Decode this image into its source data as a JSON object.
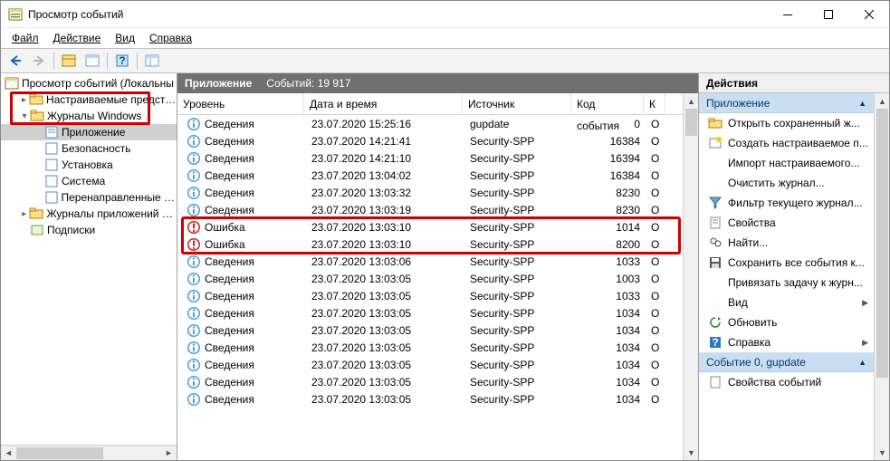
{
  "window": {
    "title": "Просмотр событий"
  },
  "menu": {
    "file": "Файл",
    "action": "Действие",
    "view": "Вид",
    "help": "Справка"
  },
  "tree": {
    "root": "Просмотр событий (Локальны",
    "custom_views": "Настраиваемые представле",
    "win_logs": "Журналы Windows",
    "application": "Приложение",
    "security": "Безопасность",
    "setup": "Установка",
    "system": "Система",
    "forwarded": "Перенаправленные соб",
    "apps_services": "Журналы приложений и сл",
    "subscriptions": "Подписки"
  },
  "center": {
    "title": "Приложение",
    "count_label": "Событий: 19 917",
    "columns": {
      "level": "Уровень",
      "date": "Дата и время",
      "source": "Источник",
      "code": "Код события",
      "k": "К"
    },
    "info_label": "Сведения",
    "error_label": "Ошибка",
    "rows": [
      {
        "lvl": "i",
        "date": "23.07.2020 15:25:16",
        "src": "gupdate",
        "code": "0",
        "k": "О"
      },
      {
        "lvl": "i",
        "date": "23.07.2020 14:21:41",
        "src": "Security-SPP",
        "code": "16384",
        "k": "О"
      },
      {
        "lvl": "i",
        "date": "23.07.2020 14:21:10",
        "src": "Security-SPP",
        "code": "16394",
        "k": "О"
      },
      {
        "lvl": "i",
        "date": "23.07.2020 13:04:02",
        "src": "Security-SPP",
        "code": "16384",
        "k": "О"
      },
      {
        "lvl": "i",
        "date": "23.07.2020 13:03:32",
        "src": "Security-SPP",
        "code": "8230",
        "k": "О"
      },
      {
        "lvl": "i",
        "date": "23.07.2020 13:03:19",
        "src": "Security-SPP",
        "code": "8230",
        "k": "О"
      },
      {
        "lvl": "e",
        "date": "23.07.2020 13:03:10",
        "src": "Security-SPP",
        "code": "1014",
        "k": "О"
      },
      {
        "lvl": "e",
        "date": "23.07.2020 13:03:10",
        "src": "Security-SPP",
        "code": "8200",
        "k": "О"
      },
      {
        "lvl": "i",
        "date": "23.07.2020 13:03:06",
        "src": "Security-SPP",
        "code": "1033",
        "k": "О"
      },
      {
        "lvl": "i",
        "date": "23.07.2020 13:03:05",
        "src": "Security-SPP",
        "code": "1003",
        "k": "О"
      },
      {
        "lvl": "i",
        "date": "23.07.2020 13:03:05",
        "src": "Security-SPP",
        "code": "1033",
        "k": "О"
      },
      {
        "lvl": "i",
        "date": "23.07.2020 13:03:05",
        "src": "Security-SPP",
        "code": "1034",
        "k": "О"
      },
      {
        "lvl": "i",
        "date": "23.07.2020 13:03:05",
        "src": "Security-SPP",
        "code": "1034",
        "k": "О"
      },
      {
        "lvl": "i",
        "date": "23.07.2020 13:03:05",
        "src": "Security-SPP",
        "code": "1034",
        "k": "О"
      },
      {
        "lvl": "i",
        "date": "23.07.2020 13:03:05",
        "src": "Security-SPP",
        "code": "1034",
        "k": "О"
      },
      {
        "lvl": "i",
        "date": "23.07.2020 13:03:05",
        "src": "Security-SPP",
        "code": "1034",
        "k": "О"
      },
      {
        "lvl": "i",
        "date": "23.07.2020 13:03:05",
        "src": "Security-SPP",
        "code": "1034",
        "k": "О"
      }
    ]
  },
  "actions": {
    "header": "Действия",
    "section1": "Приложение",
    "open_saved": "Открыть сохраненный ж...",
    "create_custom": "Создать настраиваемое п...",
    "import_custom": "Импорт настраиваемого...",
    "clear_log": "Очистить журнал...",
    "filter_log": "Фильтр текущего журнал...",
    "properties": "Свойства",
    "find": "Найти...",
    "save_all": "Сохранить все события к...",
    "attach_task": "Привязать задачу к журн...",
    "view": "Вид",
    "refresh": "Обновить",
    "help": "Справка",
    "section2": "Событие 0, gupdate",
    "event_props": "Свойства событий"
  }
}
